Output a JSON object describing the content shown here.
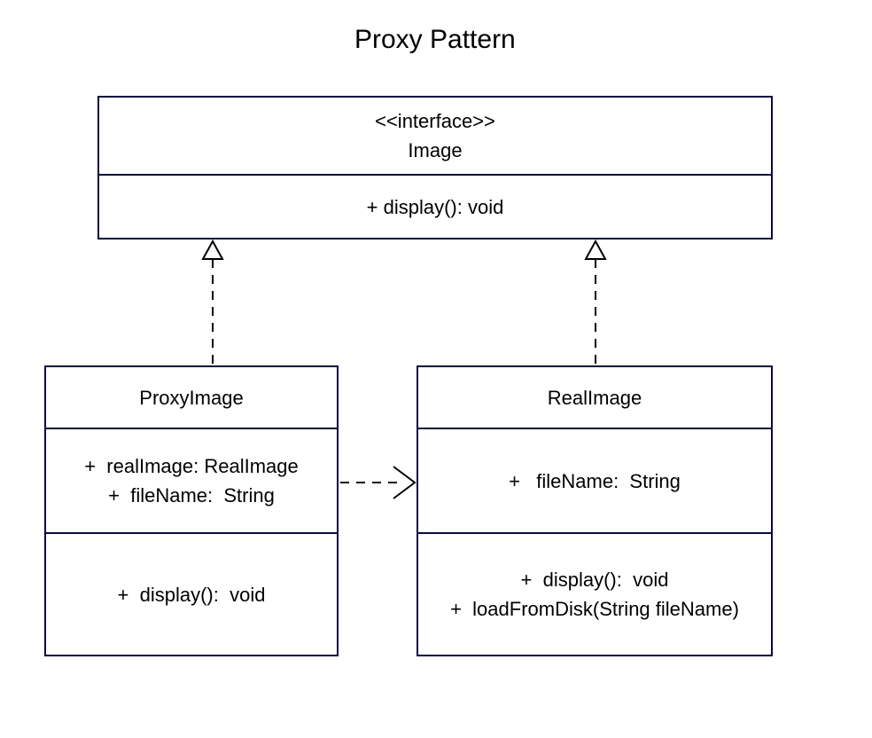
{
  "title": "Proxy Pattern",
  "interface_box": {
    "stereotype": "<<interface>>",
    "name": "Image",
    "methods": [
      "+ display(): void"
    ]
  },
  "proxy_box": {
    "name": "ProxyImage",
    "attributes": [
      "+  realImage: RealImage",
      "+  fileName:  String"
    ],
    "methods": [
      "+  display():  void"
    ]
  },
  "real_box": {
    "name": "RealImage",
    "attributes": [
      "+   fileName:  String"
    ],
    "methods": [
      "+  display():  void",
      "+  loadFromDisk(String fileName)"
    ]
  },
  "relations": {
    "proxy_to_interface": "realization",
    "real_to_interface": "realization",
    "proxy_to_real": "dependency"
  }
}
